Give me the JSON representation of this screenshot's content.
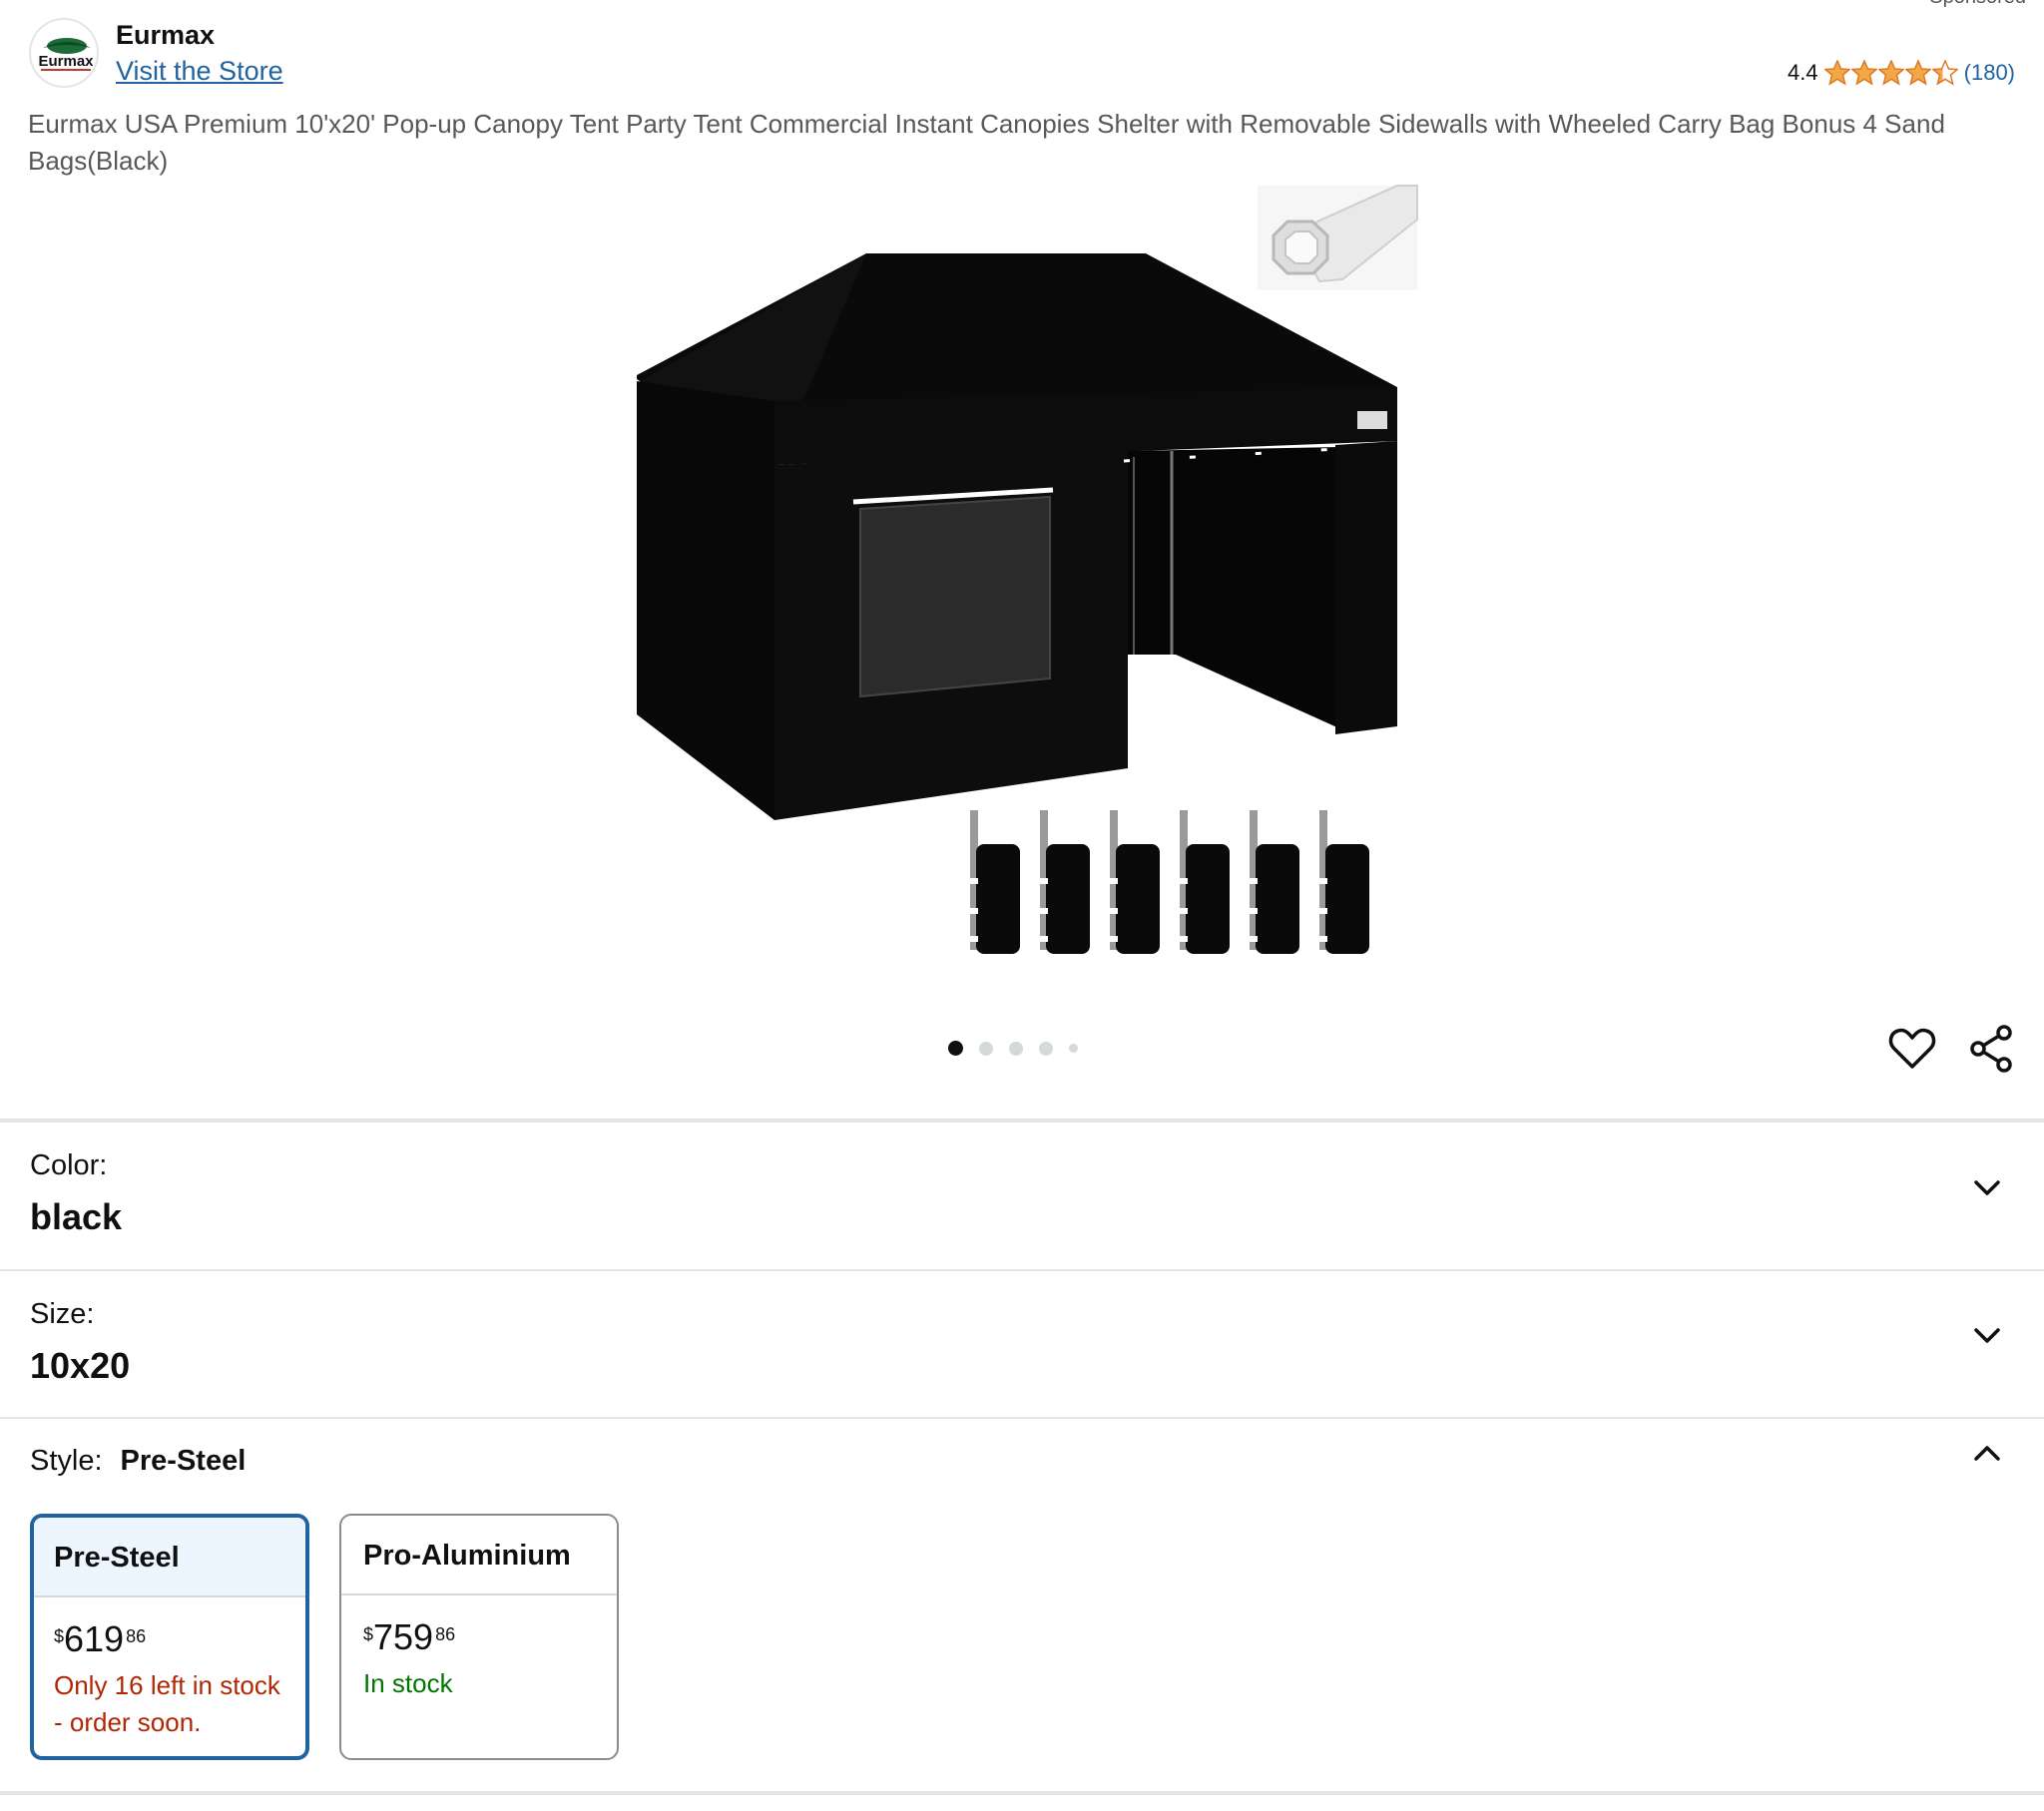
{
  "brand": {
    "name": "Eurmax",
    "logo_text": "Eurmax",
    "store_link": "Visit the Store",
    "sponsored_hint": "Sponsored"
  },
  "rating": {
    "value": "4.4",
    "stars": 4.4,
    "count": "(180)",
    "star_color": "#f3a847"
  },
  "product": {
    "title": "Eurmax USA Premium 10'x20' Pop-up Canopy Tent Party Tent Commercial Instant Canopies Shelter with Removable Sidewalls with Wheeled Carry Bag Bonus 4 Sand Bags(Black)",
    "image_desc_icon": "product-image"
  },
  "carousel": {
    "total": 5,
    "active": 1
  },
  "actions": {
    "heart_icon": "heart-icon",
    "share_icon": "share-icon"
  },
  "variations": {
    "color": {
      "label": "Color:",
      "value": "black"
    },
    "size": {
      "label": "Size:",
      "value": "10x20"
    },
    "style": {
      "label": "Style:",
      "value": "Pre-Steel",
      "options": [
        {
          "name": "Pre-Steel",
          "price_symbol": "$",
          "price_whole": "619",
          "price_fraction": "86",
          "availability": "Only 16 left in stock - order soon.",
          "selected": true
        },
        {
          "name": "Pro-Aluminium",
          "price_symbol": "$",
          "price_whole": "759",
          "price_fraction": "86",
          "availability": "In stock",
          "selected": false
        }
      ]
    }
  },
  "colors": {
    "link": "#2162a1",
    "low_stock": "#b12704",
    "in_stock": "#007600",
    "selected_border": "#2162a1",
    "selected_bg": "#edf6ff"
  }
}
